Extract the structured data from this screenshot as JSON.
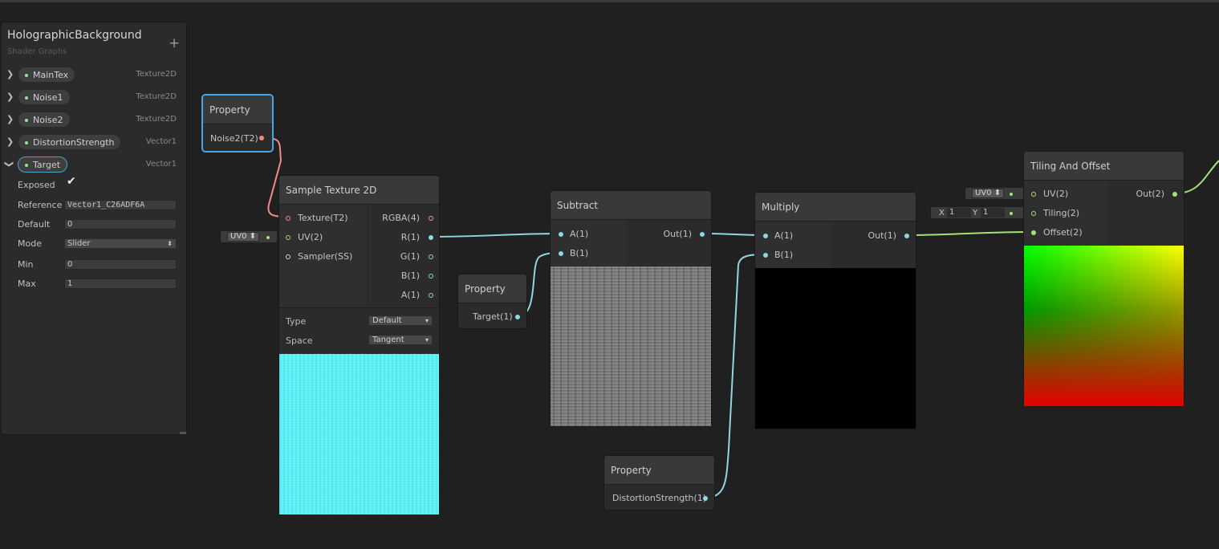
{
  "blackboard": {
    "title": "HolographicBackground",
    "subtitle": "Shader Graphs",
    "add_label": "+",
    "properties": [
      {
        "name": "MainTex",
        "type": "Texture2D",
        "expanded": false
      },
      {
        "name": "Noise1",
        "type": "Texture2D",
        "expanded": false
      },
      {
        "name": "Noise2",
        "type": "Texture2D",
        "expanded": false
      },
      {
        "name": "DistortionStrength",
        "type": "Vector1",
        "expanded": false
      },
      {
        "name": "Target",
        "type": "Vector1",
        "expanded": true
      }
    ],
    "expanded_fields": {
      "exposed_label": "Exposed",
      "exposed_check": "✔",
      "reference_label": "Reference",
      "reference_value": "Vector1_C26ADF6A",
      "default_label": "Default",
      "default_value": "0",
      "mode_label": "Mode",
      "mode_value": "Slider",
      "min_label": "Min",
      "min_value": "0",
      "max_label": "Max",
      "max_value": "1"
    }
  },
  "nodes": {
    "property_noise2": {
      "title": "Property",
      "port": "Noise2(T2)"
    },
    "sample_texture": {
      "title": "Sample Texture 2D",
      "inputs": [
        "Texture(T2)",
        "UV(2)",
        "Sampler(SS)"
      ],
      "outputs": [
        "RGBA(4)",
        "R(1)",
        "G(1)",
        "B(1)",
        "A(1)"
      ],
      "type_label": "Type",
      "type_value": "Default",
      "space_label": "Space",
      "space_value": "Tangent",
      "uv_stub": "UV0 ⬍"
    },
    "property_target": {
      "title": "Property",
      "port": "Target(1)"
    },
    "subtract": {
      "title": "Subtract",
      "inputs": [
        "A(1)",
        "B(1)"
      ],
      "output": "Out(1)"
    },
    "multiply": {
      "title": "Multiply",
      "inputs": [
        "A(1)",
        "B(1)"
      ],
      "output": "Out(1)"
    },
    "property_distortion": {
      "title": "Property",
      "port": "DistortionStrength(1)"
    },
    "tiling_offset": {
      "title": "Tiling And Offset",
      "inputs": [
        "UV(2)",
        "Tiling(2)",
        "Offset(2)"
      ],
      "output": "Out(2)",
      "uv_stub": "UV0 ⬍",
      "tiling_x_label": "X",
      "tiling_x": "1",
      "tiling_y_label": "Y",
      "tiling_y": "1"
    }
  },
  "colors": {
    "background": "#202020",
    "wire_float": "#90d7e1",
    "wire_texture": "#ef8b8b",
    "wire_vector2": "#a5e27a",
    "selection": "#44a8e4"
  }
}
